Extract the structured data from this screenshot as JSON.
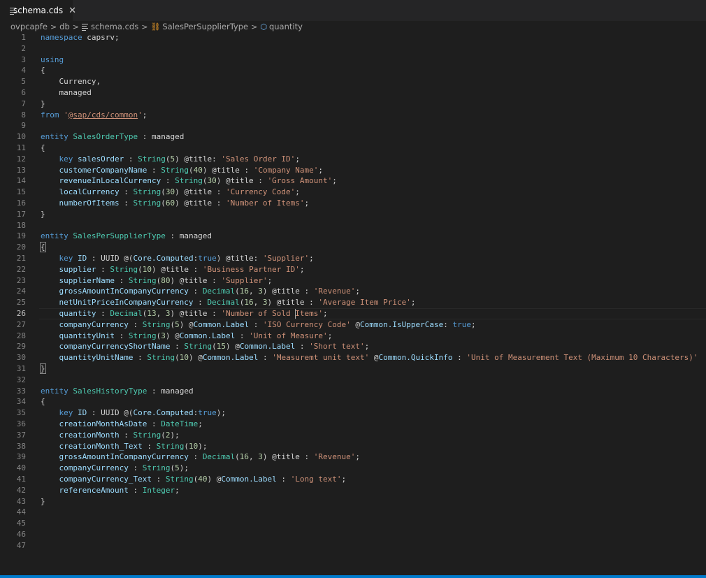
{
  "tab": {
    "label": "schema.cds",
    "close_icon": "close-icon"
  },
  "breadcrumb": {
    "items": [
      "ovpcapfe",
      "db",
      "schema.cds",
      "SalesPerSupplierType",
      "quantity"
    ],
    "separator": ">"
  },
  "editor": {
    "current_line": 26,
    "lines": [
      {
        "n": "1",
        "tokens": [
          {
            "c": "k",
            "t": "namespace"
          },
          {
            "t": " capsrv;"
          }
        ]
      },
      {
        "n": "2",
        "tokens": []
      },
      {
        "n": "3",
        "tokens": [
          {
            "c": "k",
            "t": "using"
          }
        ]
      },
      {
        "n": "4",
        "tokens": [
          {
            "t": "{"
          }
        ]
      },
      {
        "n": "5",
        "tokens": [
          {
            "t": "    Currency,"
          }
        ]
      },
      {
        "n": "6",
        "tokens": [
          {
            "t": "    managed"
          }
        ]
      },
      {
        "n": "7",
        "tokens": [
          {
            "t": "}"
          }
        ]
      },
      {
        "n": "8",
        "tokens": [
          {
            "c": "k",
            "t": "from"
          },
          {
            "t": " "
          },
          {
            "c": "s",
            "t": "'"
          },
          {
            "c": "u",
            "t": "@sap/cds/common"
          },
          {
            "c": "s",
            "t": "'"
          },
          {
            "t": ";"
          }
        ]
      },
      {
        "n": "9",
        "tokens": []
      },
      {
        "n": "10",
        "tokens": [
          {
            "c": "k",
            "t": "entity"
          },
          {
            "t": " "
          },
          {
            "c": "t",
            "t": "SalesOrderType"
          },
          {
            "t": " : managed"
          }
        ]
      },
      {
        "n": "11",
        "tokens": [
          {
            "t": "{"
          }
        ]
      },
      {
        "n": "12",
        "tokens": [
          {
            "t": "    "
          },
          {
            "c": "k",
            "t": "key"
          },
          {
            "t": " "
          },
          {
            "c": "p",
            "t": "salesOrder"
          },
          {
            "t": " : "
          },
          {
            "c": "t",
            "t": "String"
          },
          {
            "t": "("
          },
          {
            "c": "n",
            "t": "5"
          },
          {
            "t": ") @title: "
          },
          {
            "c": "s",
            "t": "'Sales Order ID'"
          },
          {
            "t": ";"
          }
        ]
      },
      {
        "n": "13",
        "tokens": [
          {
            "t": "    "
          },
          {
            "c": "p",
            "t": "customerCompanyName"
          },
          {
            "t": " : "
          },
          {
            "c": "t",
            "t": "String"
          },
          {
            "t": "("
          },
          {
            "c": "n",
            "t": "40"
          },
          {
            "t": ") @title : "
          },
          {
            "c": "s",
            "t": "'Company Name'"
          },
          {
            "t": ";"
          }
        ]
      },
      {
        "n": "14",
        "tokens": [
          {
            "t": "    "
          },
          {
            "c": "p",
            "t": "revenueInLocalCurrency"
          },
          {
            "t": " : "
          },
          {
            "c": "t",
            "t": "String"
          },
          {
            "t": "("
          },
          {
            "c": "n",
            "t": "30"
          },
          {
            "t": ") @title : "
          },
          {
            "c": "s",
            "t": "'Gross Amount'"
          },
          {
            "t": ";"
          }
        ]
      },
      {
        "n": "15",
        "tokens": [
          {
            "t": "    "
          },
          {
            "c": "p",
            "t": "localCurrency"
          },
          {
            "t": " : "
          },
          {
            "c": "t",
            "t": "String"
          },
          {
            "t": "("
          },
          {
            "c": "n",
            "t": "30"
          },
          {
            "t": ") @title : "
          },
          {
            "c": "s",
            "t": "'Currency Code'"
          },
          {
            "t": ";"
          }
        ]
      },
      {
        "n": "16",
        "tokens": [
          {
            "t": "    "
          },
          {
            "c": "p",
            "t": "numberOfItems"
          },
          {
            "t": " : "
          },
          {
            "c": "t",
            "t": "String"
          },
          {
            "t": "("
          },
          {
            "c": "n",
            "t": "60"
          },
          {
            "t": ") @title : "
          },
          {
            "c": "s",
            "t": "'Number of Items'"
          },
          {
            "t": ";"
          }
        ]
      },
      {
        "n": "17",
        "tokens": [
          {
            "t": "}"
          }
        ]
      },
      {
        "n": "18",
        "tokens": []
      },
      {
        "n": "19",
        "tokens": [
          {
            "c": "k",
            "t": "entity"
          },
          {
            "t": " "
          },
          {
            "c": "t",
            "t": "SalesPerSupplierType"
          },
          {
            "t": " : managed"
          }
        ]
      },
      {
        "n": "20",
        "tokens": [
          {
            "c": "bm",
            "t": "{"
          }
        ]
      },
      {
        "n": "21",
        "tokens": [
          {
            "t": "    "
          },
          {
            "c": "k",
            "t": "key"
          },
          {
            "t": " "
          },
          {
            "c": "p",
            "t": "ID"
          },
          {
            "t": " : UUID @("
          },
          {
            "c": "p",
            "t": "Core.Computed"
          },
          {
            "t": ":"
          },
          {
            "c": "k",
            "t": "true"
          },
          {
            "t": ") @title: "
          },
          {
            "c": "s",
            "t": "'Supplier'"
          },
          {
            "t": ";"
          }
        ]
      },
      {
        "n": "22",
        "tokens": [
          {
            "t": "    "
          },
          {
            "c": "p",
            "t": "supplier"
          },
          {
            "t": " : "
          },
          {
            "c": "t",
            "t": "String"
          },
          {
            "t": "("
          },
          {
            "c": "n",
            "t": "10"
          },
          {
            "t": ") @title : "
          },
          {
            "c": "s",
            "t": "'Business Partner ID'"
          },
          {
            "t": ";"
          }
        ]
      },
      {
        "n": "23",
        "tokens": [
          {
            "t": "    "
          },
          {
            "c": "p",
            "t": "supplierName"
          },
          {
            "t": " : "
          },
          {
            "c": "t",
            "t": "String"
          },
          {
            "t": "("
          },
          {
            "c": "n",
            "t": "80"
          },
          {
            "t": ") @title : "
          },
          {
            "c": "s",
            "t": "'Supplier'"
          },
          {
            "t": ";"
          }
        ]
      },
      {
        "n": "24",
        "tokens": [
          {
            "t": "    "
          },
          {
            "c": "p",
            "t": "grossAmountInCompanyCurrency"
          },
          {
            "t": " : "
          },
          {
            "c": "t",
            "t": "Decimal"
          },
          {
            "t": "("
          },
          {
            "c": "n",
            "t": "16"
          },
          {
            "t": ", "
          },
          {
            "c": "n",
            "t": "3"
          },
          {
            "t": ") @title : "
          },
          {
            "c": "s",
            "t": "'Revenue'"
          },
          {
            "t": ";"
          }
        ]
      },
      {
        "n": "25",
        "tokens": [
          {
            "t": "    "
          },
          {
            "c": "p",
            "t": "netUnitPriceInCompanyCurrency"
          },
          {
            "t": " : "
          },
          {
            "c": "t",
            "t": "Decimal"
          },
          {
            "t": "("
          },
          {
            "c": "n",
            "t": "16"
          },
          {
            "t": ", "
          },
          {
            "c": "n",
            "t": "3"
          },
          {
            "t": ") @title : "
          },
          {
            "c": "s",
            "t": "'Average Item Price'"
          },
          {
            "t": ";"
          }
        ]
      },
      {
        "n": "26",
        "tokens": [
          {
            "t": "    "
          },
          {
            "c": "p",
            "t": "quantity"
          },
          {
            "t": " : "
          },
          {
            "c": "t",
            "t": "Decimal"
          },
          {
            "t": "("
          },
          {
            "c": "n",
            "t": "13"
          },
          {
            "t": ", "
          },
          {
            "c": "n",
            "t": "3"
          },
          {
            "t": ") @title : "
          },
          {
            "c": "s",
            "t": "'Number of Sold "
          },
          {
            "c": "cursor",
            "t": ""
          },
          {
            "c": "s",
            "t": "Items'"
          },
          {
            "t": ";"
          }
        ]
      },
      {
        "n": "27",
        "tokens": [
          {
            "t": "    "
          },
          {
            "c": "p",
            "t": "companyCurrency"
          },
          {
            "t": " : "
          },
          {
            "c": "t",
            "t": "String"
          },
          {
            "t": "("
          },
          {
            "c": "n",
            "t": "5"
          },
          {
            "t": ") @"
          },
          {
            "c": "p",
            "t": "Common.Label"
          },
          {
            "t": " : "
          },
          {
            "c": "s",
            "t": "'ISO Currency Code'"
          },
          {
            "t": " @"
          },
          {
            "c": "p",
            "t": "Common.IsUpperCase"
          },
          {
            "t": ": "
          },
          {
            "c": "k",
            "t": "true"
          },
          {
            "t": ";"
          }
        ]
      },
      {
        "n": "28",
        "tokens": [
          {
            "t": "    "
          },
          {
            "c": "p",
            "t": "quantityUnit"
          },
          {
            "t": " : "
          },
          {
            "c": "t",
            "t": "String"
          },
          {
            "t": "("
          },
          {
            "c": "n",
            "t": "3"
          },
          {
            "t": ") @"
          },
          {
            "c": "p",
            "t": "Common.Label"
          },
          {
            "t": " : "
          },
          {
            "c": "s",
            "t": "'Unit of Measure'"
          },
          {
            "t": ";"
          }
        ]
      },
      {
        "n": "29",
        "tokens": [
          {
            "t": "    "
          },
          {
            "c": "p",
            "t": "companyCurrencyShortName"
          },
          {
            "t": " : "
          },
          {
            "c": "t",
            "t": "String"
          },
          {
            "t": "("
          },
          {
            "c": "n",
            "t": "15"
          },
          {
            "t": ") @"
          },
          {
            "c": "p",
            "t": "Common.Label"
          },
          {
            "t": " : "
          },
          {
            "c": "s",
            "t": "'Short text'"
          },
          {
            "t": ";"
          }
        ]
      },
      {
        "n": "30",
        "tokens": [
          {
            "t": "    "
          },
          {
            "c": "p",
            "t": "quantityUnitName"
          },
          {
            "t": " : "
          },
          {
            "c": "t",
            "t": "String"
          },
          {
            "t": "("
          },
          {
            "c": "n",
            "t": "10"
          },
          {
            "t": ") @"
          },
          {
            "c": "p",
            "t": "Common.Label"
          },
          {
            "t": " : "
          },
          {
            "c": "s",
            "t": "'Measuremt unit text'"
          },
          {
            "t": " @"
          },
          {
            "c": "p",
            "t": "Common.QuickInfo"
          },
          {
            "t": " : "
          },
          {
            "c": "s",
            "t": "'Unit of Measurement Text (Maximum 10 Characters)'"
          }
        ]
      },
      {
        "n": "31",
        "tokens": [
          {
            "c": "bm",
            "t": "}"
          }
        ]
      },
      {
        "n": "32",
        "tokens": []
      },
      {
        "n": "33",
        "tokens": [
          {
            "c": "k",
            "t": "entity"
          },
          {
            "t": " "
          },
          {
            "c": "t",
            "t": "SalesHistoryType"
          },
          {
            "t": " : managed"
          }
        ]
      },
      {
        "n": "34",
        "tokens": [
          {
            "t": "{"
          }
        ]
      },
      {
        "n": "35",
        "tokens": [
          {
            "t": "    "
          },
          {
            "c": "k",
            "t": "key"
          },
          {
            "t": " "
          },
          {
            "c": "p",
            "t": "ID"
          },
          {
            "t": " : UUID @("
          },
          {
            "c": "p",
            "t": "Core.Computed"
          },
          {
            "t": ":"
          },
          {
            "c": "k",
            "t": "true"
          },
          {
            "t": ");"
          }
        ]
      },
      {
        "n": "36",
        "tokens": [
          {
            "t": "    "
          },
          {
            "c": "p",
            "t": "creationMonthAsDate"
          },
          {
            "t": " : "
          },
          {
            "c": "t",
            "t": "DateTime"
          },
          {
            "t": ";"
          }
        ]
      },
      {
        "n": "37",
        "tokens": [
          {
            "t": "    "
          },
          {
            "c": "p",
            "t": "creationMonth"
          },
          {
            "t": " : "
          },
          {
            "c": "t",
            "t": "String"
          },
          {
            "t": "("
          },
          {
            "c": "n",
            "t": "2"
          },
          {
            "t": ");"
          }
        ]
      },
      {
        "n": "38",
        "tokens": [
          {
            "t": "    "
          },
          {
            "c": "p",
            "t": "creationMonth_Text"
          },
          {
            "t": " : "
          },
          {
            "c": "t",
            "t": "String"
          },
          {
            "t": "("
          },
          {
            "c": "n",
            "t": "10"
          },
          {
            "t": ");"
          }
        ]
      },
      {
        "n": "39",
        "tokens": [
          {
            "t": "    "
          },
          {
            "c": "p",
            "t": "grossAmountInCompanyCurrency"
          },
          {
            "t": " : "
          },
          {
            "c": "t",
            "t": "Decimal"
          },
          {
            "t": "("
          },
          {
            "c": "n",
            "t": "16"
          },
          {
            "t": ", "
          },
          {
            "c": "n",
            "t": "3"
          },
          {
            "t": ") @title : "
          },
          {
            "c": "s",
            "t": "'Revenue'"
          },
          {
            "t": ";"
          }
        ]
      },
      {
        "n": "40",
        "tokens": [
          {
            "t": "    "
          },
          {
            "c": "p",
            "t": "companyCurrency"
          },
          {
            "t": " : "
          },
          {
            "c": "t",
            "t": "String"
          },
          {
            "t": "("
          },
          {
            "c": "n",
            "t": "5"
          },
          {
            "t": ");"
          }
        ]
      },
      {
        "n": "41",
        "tokens": [
          {
            "t": "    "
          },
          {
            "c": "p",
            "t": "companyCurrency_Text"
          },
          {
            "t": " : "
          },
          {
            "c": "t",
            "t": "String"
          },
          {
            "t": "("
          },
          {
            "c": "n",
            "t": "40"
          },
          {
            "t": ") @"
          },
          {
            "c": "p",
            "t": "Common.Label"
          },
          {
            "t": " : "
          },
          {
            "c": "s",
            "t": "'Long text'"
          },
          {
            "t": ";"
          }
        ]
      },
      {
        "n": "42",
        "tokens": [
          {
            "t": "    "
          },
          {
            "c": "p",
            "t": "referenceAmount"
          },
          {
            "t": " : "
          },
          {
            "c": "t",
            "t": "Integer"
          },
          {
            "t": ";"
          }
        ]
      },
      {
        "n": "43",
        "tokens": [
          {
            "t": "}"
          }
        ]
      },
      {
        "n": "44",
        "tokens": []
      },
      {
        "n": "45",
        "tokens": []
      },
      {
        "n": "46",
        "tokens": []
      },
      {
        "n": "47",
        "tokens": []
      }
    ]
  },
  "colors": {
    "editor_bg": "#1e1e1e",
    "tabbar_bg": "#252526",
    "keyword": "#569cd6",
    "type": "#4ec9b0",
    "property": "#9cdcfe",
    "string": "#ce9178",
    "number": "#b5cea8",
    "statusbar": "#007acc"
  }
}
